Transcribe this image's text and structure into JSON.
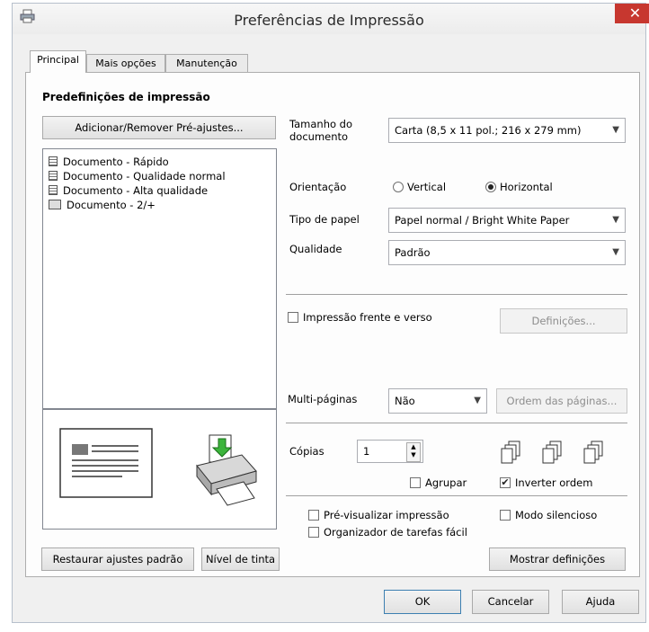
{
  "window": {
    "title": "Preferências de Impressão",
    "close": "✕"
  },
  "tabs": [
    "Principal",
    "Mais opções",
    "Manutenção"
  ],
  "presets": {
    "heading": "Predefinições de impressão",
    "add_remove_button": "Adicionar/Remover Pré-ajustes...",
    "items": [
      "Documento - Rápido",
      "Documento - Qualidade normal",
      "Documento - Alta qualidade",
      "Documento - 2/+"
    ]
  },
  "document_size": {
    "label_line1": "Tamanho do",
    "label_line2": "documento",
    "value": "Carta (8,5 x 11 pol.; 216 x 279 mm)"
  },
  "orientation": {
    "label": "Orientação",
    "vertical": "Vertical",
    "horizontal": "Horizontal",
    "selected": "Horizontal"
  },
  "paper_type": {
    "label": "Tipo de papel",
    "value": "Papel normal / Bright White Paper"
  },
  "quality": {
    "label": "Qualidade",
    "value": "Padrão"
  },
  "duplex": {
    "label": "Impressão frente e verso",
    "checked": false,
    "settings_button": "Definições..."
  },
  "multipage": {
    "label": "Multi-páginas",
    "value": "Não",
    "page_order_button": "Ordem das páginas..."
  },
  "copies": {
    "label": "Cópias",
    "value": "1",
    "collate": "Agrupar",
    "collate_checked": false,
    "reverse": "Inverter ordem",
    "reverse_checked": true
  },
  "options": {
    "preview": "Pré-visualizar impressão",
    "organizer": "Organizador de tarefas fácil",
    "silent": "Modo silencioso"
  },
  "buttons": {
    "restore": "Restaurar ajustes padrão",
    "ink": "Nível de tinta",
    "show_settings": "Mostrar definições",
    "ok": "OK",
    "cancel": "Cancelar",
    "help": "Ajuda"
  },
  "icons": {
    "printer": "printer-icon",
    "arrow": "chevron-down-icon",
    "check": "✔"
  }
}
